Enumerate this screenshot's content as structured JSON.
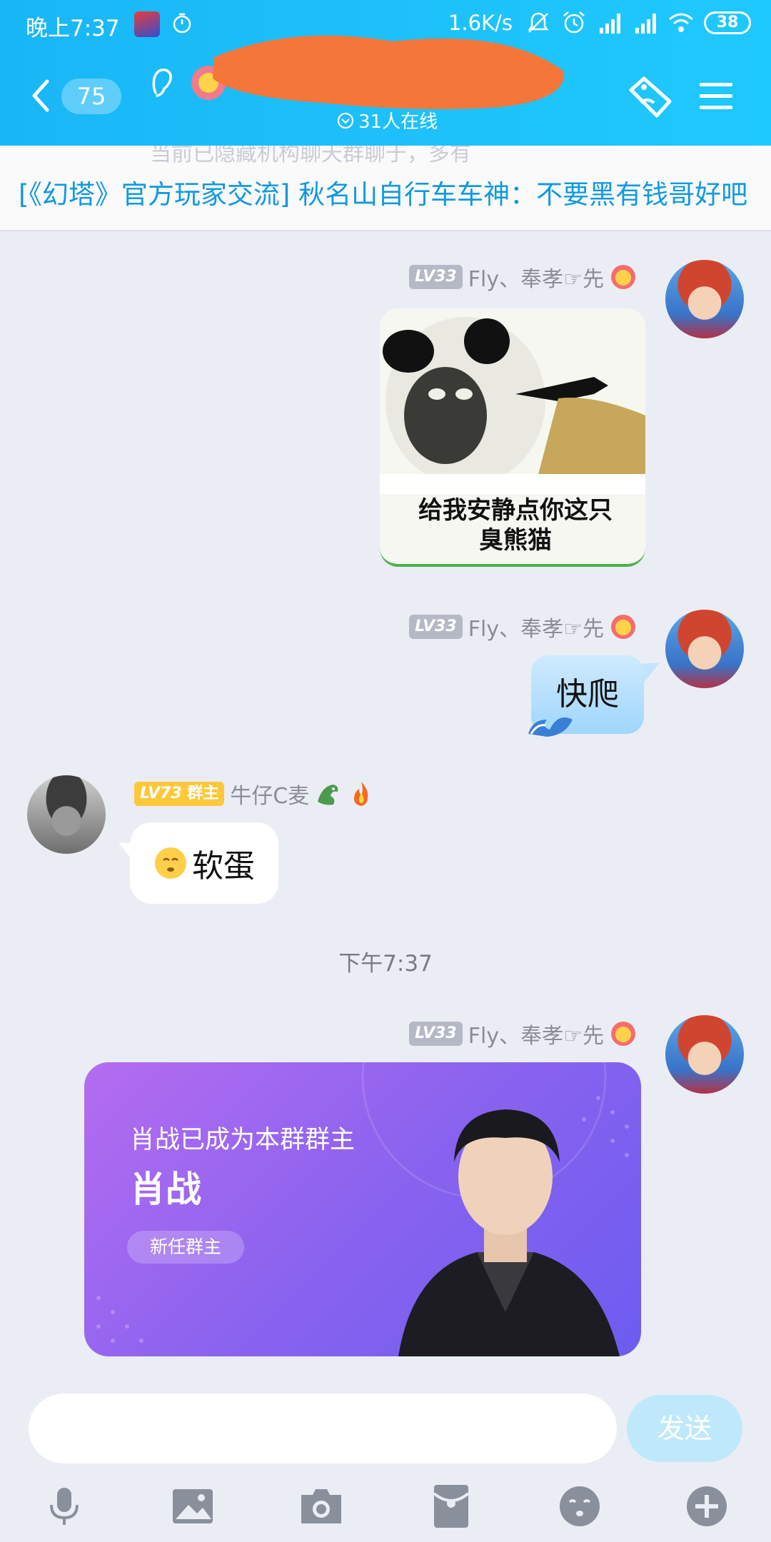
{
  "status_bar": {
    "time": "晚上7:37",
    "net_speed": "1.6K/s",
    "battery": "38"
  },
  "header": {
    "unread_count": "75",
    "online_text": "31人在线"
  },
  "banner": {
    "ghost_text": "当前已隐藏机构聊天群聊于，多有",
    "text": "[《幻塔》官方玩家交流] 秋名山自行车车神：不要黑有钱哥好吧"
  },
  "messages": [
    {
      "level": "LV33",
      "sender": "Fly、奉孝☞先",
      "sticker_caption": "给我安静点你这只臭熊猫"
    },
    {
      "level": "LV33",
      "sender": "Fly、奉孝☞先",
      "text": "快爬"
    },
    {
      "level": "LV73",
      "role": "群主",
      "sender": "牛仔C麦",
      "text": "软蛋"
    }
  ],
  "timestamp": "下午7:37",
  "card_message": {
    "level": "LV33",
    "sender": "Fly、奉孝☞先",
    "subtitle": "肖战已成为本群群主",
    "name": "肖战",
    "pill": "新任群主"
  },
  "input": {
    "placeholder": "",
    "send_label": "发送"
  },
  "colors": {
    "header_gradient_start": "#19b6f6",
    "banner_text": "#1199e0",
    "send_button": "#bfe8fb",
    "owner_badge": "#ffc83a"
  },
  "toolbar_icons": [
    "microphone-icon",
    "image-icon",
    "camera-icon",
    "red-packet-icon",
    "emoji-icon",
    "plus-icon"
  ]
}
